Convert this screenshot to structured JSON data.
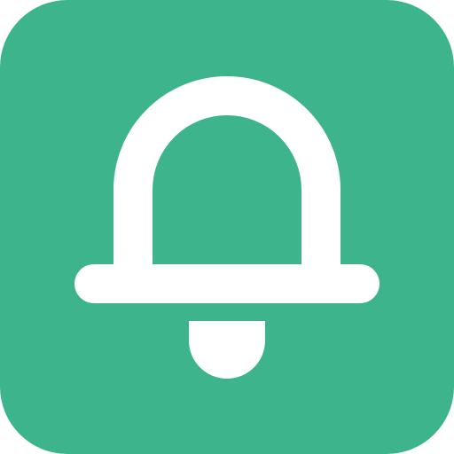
{
  "icon": {
    "name": "bell-icon",
    "background_color": "#3DB48B",
    "foreground_color": "#FFFFFF"
  }
}
